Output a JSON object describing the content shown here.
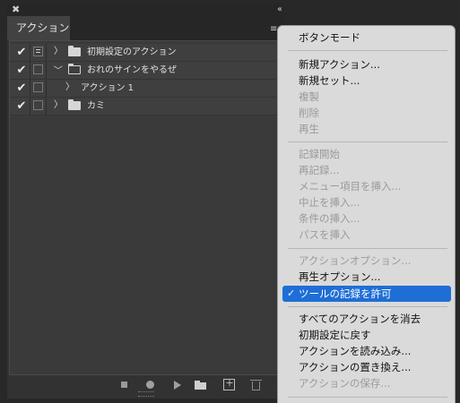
{
  "panel": {
    "close_glyph": "✖",
    "collapse_glyph": "‹‹",
    "tab_label": "アクション",
    "menu_glyph": "≡",
    "rows": [
      {
        "label": "初期設定のアクション",
        "checked": "✔"
      },
      {
        "label": "おれのサインをやるぜ",
        "checked": "✔"
      },
      {
        "label": "アクション 1",
        "checked": "✔"
      },
      {
        "label": "カミ",
        "checked": "✔"
      }
    ]
  },
  "menu": {
    "items": [
      {
        "label": "ボタンモード",
        "enabled": true
      },
      {
        "label": "新規アクション...",
        "enabled": true
      },
      {
        "label": "新規セット...",
        "enabled": true
      },
      {
        "label": "複製",
        "enabled": false
      },
      {
        "label": "削除",
        "enabled": false
      },
      {
        "label": "再生",
        "enabled": false
      },
      {
        "label": "記録開始",
        "enabled": false
      },
      {
        "label": "再記録...",
        "enabled": false
      },
      {
        "label": "メニュー項目を挿入...",
        "enabled": false
      },
      {
        "label": "中止を挿入...",
        "enabled": false
      },
      {
        "label": "条件の挿入...",
        "enabled": false
      },
      {
        "label": "パスを挿入",
        "enabled": false
      },
      {
        "label": "アクションオプション...",
        "enabled": false
      },
      {
        "label": "再生オプション...",
        "enabled": true
      },
      {
        "label": "ツールの記録を許可",
        "enabled": true,
        "checked": true,
        "check_glyph": "✓"
      },
      {
        "label": "すべてのアクションを消去",
        "enabled": true
      },
      {
        "label": "初期設定に戻す",
        "enabled": true
      },
      {
        "label": "アクションを読み込み...",
        "enabled": true
      },
      {
        "label": "アクションの置き換え...",
        "enabled": true
      },
      {
        "label": "アクションの保存...",
        "enabled": false
      }
    ]
  },
  "colors": {
    "menu_highlight": "#1e6ed6",
    "panel_bg": "#3a3a3a",
    "menu_bg": "#dadada"
  }
}
